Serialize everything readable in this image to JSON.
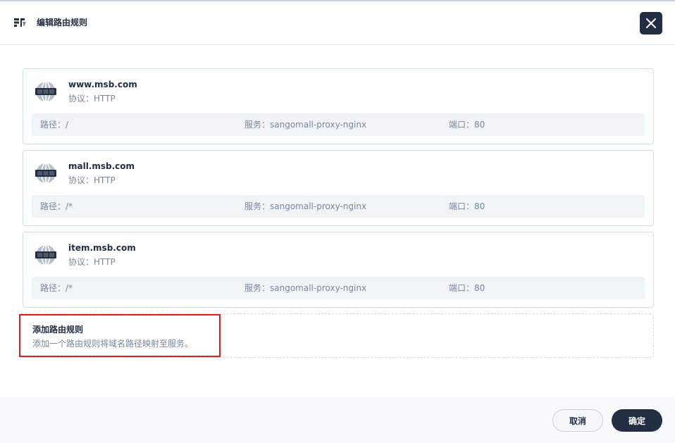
{
  "dialog": {
    "title": "编辑路由规则",
    "close_icon": "close-icon",
    "header_icon": "route-rules-icon"
  },
  "rules": [
    {
      "host": "www.msb.com",
      "protocol": "协议：HTTP",
      "path": "路径：/",
      "service": "服务：sangomall-proxy-nginx",
      "port": "端口：80",
      "icon": "globe-icon"
    },
    {
      "host": "mall.msb.com",
      "protocol": "协议：HTTP",
      "path": "路径：/*",
      "service": "服务：sangomall-proxy-nginx",
      "port": "端口：80",
      "icon": "globe-icon"
    },
    {
      "host": "item.msb.com",
      "protocol": "协议：HTTP",
      "path": "路径：/*",
      "service": "服务：sangomall-proxy-nginx",
      "port": "端口：80",
      "icon": "globe-icon"
    }
  ],
  "add_rule": {
    "title": "添加路由规则",
    "description": "添加一个路由规则将域名路径映射至服务。"
  },
  "footer": {
    "cancel_label": "取消",
    "confirm_label": "确定"
  },
  "colors": {
    "primary": "#242e42",
    "muted_text": "#79879c",
    "highlight": "#e02020"
  }
}
